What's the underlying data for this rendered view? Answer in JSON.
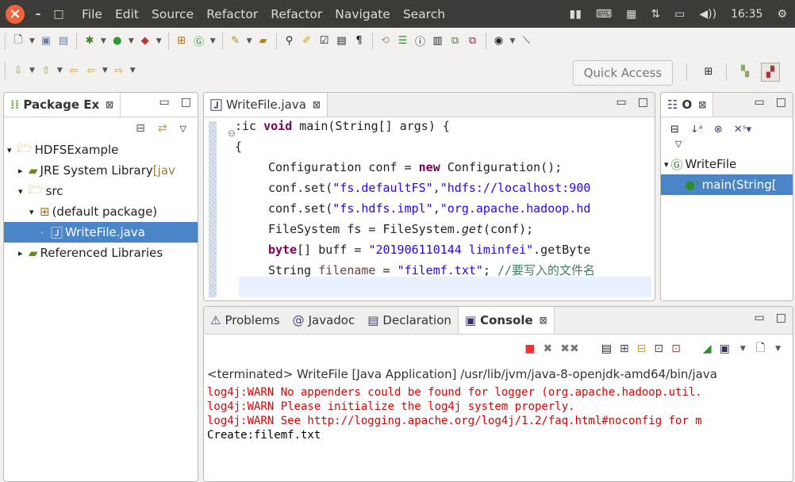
{
  "menubar": {
    "items": [
      "File",
      "Edit",
      "Source",
      "Refactor",
      "Refactor",
      "Navigate",
      "Search"
    ],
    "time": "16:35"
  },
  "quick_access": {
    "label": "Quick Access"
  },
  "package_explorer": {
    "title": "Package Ex",
    "tree": [
      {
        "label": "HDFSExample",
        "indent": 0,
        "twisty": "▾",
        "icon": "project-icon"
      },
      {
        "label": "JRE System Library",
        "suffix": "[jav",
        "indent": 1,
        "twisty": "▸",
        "icon": "library-icon"
      },
      {
        "label": "src",
        "indent": 1,
        "twisty": "▾",
        "icon": "source-folder-icon"
      },
      {
        "label": "(default package)",
        "indent": 2,
        "twisty": "▾",
        "icon": "package-icon"
      },
      {
        "label": "WriteFile.java",
        "indent": 3,
        "twisty": "",
        "icon": "java-file-icon",
        "selected": true
      },
      {
        "label": "Referenced Libraries",
        "indent": 1,
        "twisty": "▸",
        "icon": "library-icon"
      }
    ]
  },
  "editor": {
    "tab": "WriteFile.java",
    "code_lines": [
      {
        "segs": [
          {
            "t": ":ic "
          },
          {
            "t": "void",
            "c": "kw"
          },
          {
            "t": " main(String[] args) {"
          }
        ],
        "x": 40
      },
      {
        "segs": [
          {
            "t": "{"
          }
        ],
        "x": 40
      },
      {
        "segs": [
          {
            "t": "Configuration conf = "
          },
          {
            "t": "new",
            "c": "kw"
          },
          {
            "t": " Configuration();"
          }
        ],
        "x": 82
      },
      {
        "segs": [
          {
            "t": "conf.set("
          },
          {
            "t": "\"fs.defaultFS\"",
            "c": "str"
          },
          {
            "t": ","
          },
          {
            "t": "\"hdfs://localhost:900",
            "c": "str"
          }
        ],
        "x": 82
      },
      {
        "segs": [
          {
            "t": "conf.set("
          },
          {
            "t": "\"fs.hdfs.impl\"",
            "c": "str"
          },
          {
            "t": ","
          },
          {
            "t": "\"org.apache.hadoop.hd",
            "c": "str"
          }
        ],
        "x": 82
      },
      {
        "segs": [
          {
            "t": "FileSystem fs = FileSystem."
          },
          {
            "t": "get",
            "c": "it"
          },
          {
            "t": "(conf);"
          }
        ],
        "x": 82
      },
      {
        "segs": [
          {
            "t": "byte",
            "c": "kw"
          },
          {
            "t": "[] buff = "
          },
          {
            "t": "\"201906110144 liminfei\"",
            "c": "str"
          },
          {
            "t": ".getByte"
          }
        ],
        "x": 82
      },
      {
        "segs": [
          {
            "t": "String "
          },
          {
            "t": "filename",
            "c": "var"
          },
          {
            "t": " = "
          },
          {
            "t": "\"filemf.txt\"",
            "c": "str"
          },
          {
            "t": "; "
          },
          {
            "t": "//要写入的文件名",
            "c": "cm"
          }
        ],
        "x": 82
      }
    ]
  },
  "outline": {
    "title": "O",
    "class_name": "WriteFile",
    "method": "main(String["
  },
  "bottom": {
    "tabs": [
      "Problems",
      "Javadoc",
      "Declaration",
      "Console"
    ],
    "active": "Console",
    "terminated": "<terminated> WriteFile [Java Application] /usr/lib/jvm/java-8-openjdk-amd64/bin/java",
    "lines": [
      {
        "text": "log4j:WARN No appenders could be found for logger (org.apache.hadoop.util.",
        "kind": "err"
      },
      {
        "text": "log4j:WARN Please initialize the log4j system properly.",
        "kind": "err"
      },
      {
        "text": "log4j:WARN See http://logging.apache.org/log4j/1.2/faq.html#noconfig for m",
        "kind": "err"
      },
      {
        "text": "Create:filemf.txt",
        "kind": "out"
      }
    ]
  }
}
